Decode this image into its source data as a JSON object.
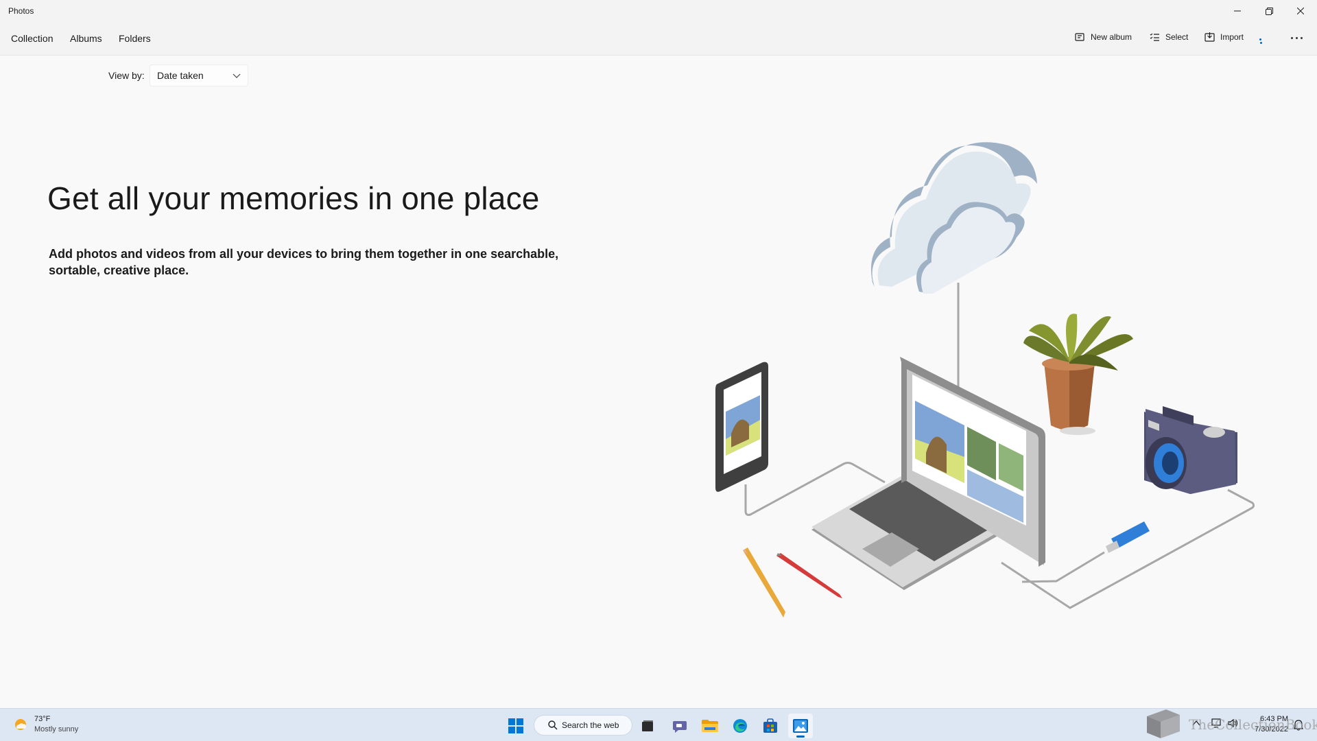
{
  "window": {
    "title": "Photos",
    "minimize_icon": "minimize-icon",
    "restore_icon": "restore-icon",
    "close_icon": "close-icon"
  },
  "nav": {
    "tabs": [
      {
        "label": "Collection"
      },
      {
        "label": "Albums"
      },
      {
        "label": "Folders"
      }
    ]
  },
  "commands": {
    "new_album": {
      "label": "New album",
      "icon": "new-album-icon"
    },
    "select": {
      "label": "Select",
      "icon": "select-list-icon"
    },
    "import": {
      "label": "Import",
      "icon": "import-icon"
    },
    "more_icon": "more-options-icon"
  },
  "view_by": {
    "label": "View by:",
    "selected": "Date taken"
  },
  "hero": {
    "title": "Get all your memories in one place",
    "description": "Add photos and videos from all your devices to bring them together in one searchable, sortable, creative place."
  },
  "taskbar": {
    "weather": {
      "temp": "73°F",
      "condition": "Mostly sunny",
      "icon": "sun-cloud-icon"
    },
    "search": {
      "label": "Search the web",
      "icon": "search-icon"
    },
    "apps": [
      "start-icon",
      "task-view-icon",
      "teams-chat-icon",
      "file-explorer-icon",
      "edge-icon",
      "store-icon",
      "photos-icon"
    ],
    "clock": {
      "time": "6:43 PM",
      "date": "7/30/2022"
    },
    "watermark": "TheCollectionBook"
  },
  "colors": {
    "accent": "#0067c0",
    "background": "#f9f9f9",
    "taskbar": "#dde6f3"
  }
}
